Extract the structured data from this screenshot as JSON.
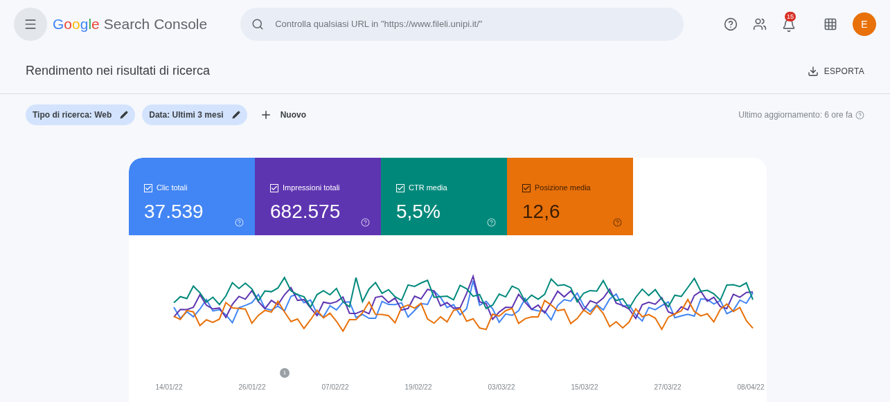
{
  "header": {
    "brand": "Google",
    "product": "Search Console",
    "search": {
      "placeholder": "Controlla qualsiasi URL in \"https://www.fileli.unipi.it/\""
    },
    "notification_count": "15",
    "avatar": "E"
  },
  "page": {
    "title": "Rendimento nei risultati di ricerca",
    "export": "ESPORTA"
  },
  "filters": [
    {
      "label": "Tipo di ricerca: Web"
    },
    {
      "label": "Data: Ultimi 3 mesi"
    }
  ],
  "new_filter": "Nuovo",
  "last_update": "Ultimo aggiornamento: 6 ore fa",
  "metrics": [
    {
      "label": "Clic totali",
      "value": "37.539",
      "selected": true,
      "color": "#4285f4"
    },
    {
      "label": "Impressioni totali",
      "value": "682.575",
      "selected": true,
      "color": "#5e35b1"
    },
    {
      "label": "CTR media",
      "value": "5,5%",
      "selected": true,
      "color": "#00897b"
    },
    {
      "label": "Posizione media",
      "value": "12,6",
      "selected": true,
      "color": "#e8710a"
    }
  ],
  "chart": {
    "x_labels": [
      "14/01/22",
      "26/01/22",
      "07/02/22",
      "19/02/22",
      "03/03/22",
      "15/03/22",
      "27/03/22",
      "08/04/22"
    ],
    "annotation": "1"
  }
}
